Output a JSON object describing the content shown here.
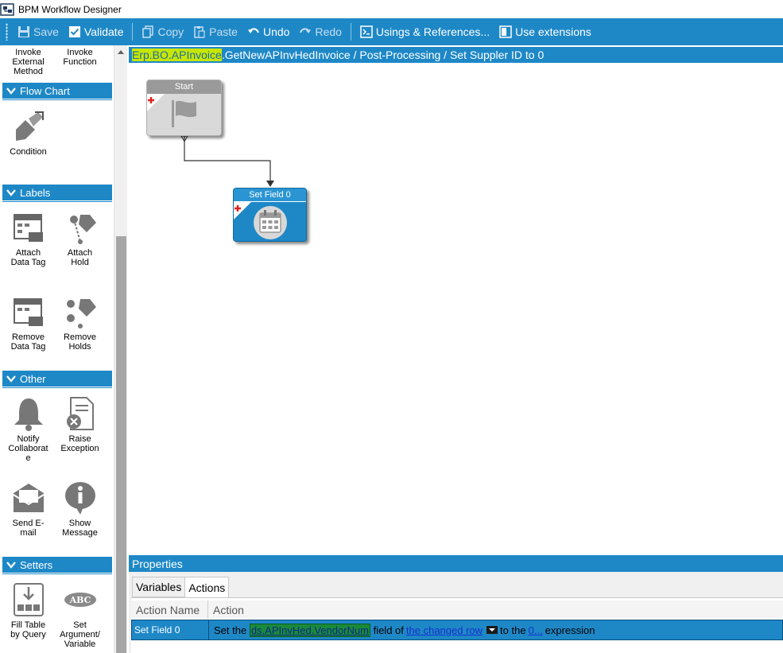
{
  "window": {
    "title": "BPM Workflow Designer"
  },
  "toolbar": {
    "save": "Save",
    "validate": "Validate",
    "copy": "Copy",
    "paste": "Paste",
    "undo": "Undo",
    "redo": "Redo",
    "usings": "Usings & References...",
    "extensions": "Use extensions"
  },
  "toolbox": {
    "top_items": [
      {
        "label": "Invoke\nExternal\nMethod"
      },
      {
        "label": "Invoke\nFunction"
      }
    ],
    "groups": {
      "flowchart": {
        "title": "Flow Chart",
        "items": [
          {
            "label": "Condition",
            "icon": "condition-icon"
          }
        ]
      },
      "labels": {
        "title": "Labels",
        "items": [
          {
            "label": "Attach\nData Tag",
            "icon": "attach-data-tag-icon"
          },
          {
            "label": "Attach\nHold",
            "icon": "attach-hold-icon"
          },
          {
            "label": "Remove\nData Tag",
            "icon": "remove-data-tag-icon"
          },
          {
            "label": "Remove\nHolds",
            "icon": "remove-holds-icon"
          }
        ]
      },
      "other": {
        "title": "Other",
        "items": [
          {
            "label": "Notify\nCollaborat\ne",
            "icon": "bell-icon"
          },
          {
            "label": "Raise\nException",
            "icon": "raise-exception-icon"
          },
          {
            "label": "Send E-\nmail",
            "icon": "envelope-icon"
          },
          {
            "label": "Show\nMessage",
            "icon": "info-bubble-icon"
          }
        ]
      },
      "setters": {
        "title": "Setters",
        "items": [
          {
            "label": "Fill Table\nby Query",
            "icon": "fill-table-icon"
          },
          {
            "label": "Set\nArgument/\nVariable",
            "icon": "abc-icon"
          }
        ]
      }
    }
  },
  "breadcrumb": {
    "highlight": "Erp.BO.APInvoice",
    "rest": ".GetNewAPInvHedInvoice / Post-Processing / Set Suppler ID to 0"
  },
  "workflow": {
    "nodes": [
      {
        "title": "Start",
        "icon": "flag-icon"
      },
      {
        "title": "Set Field 0",
        "icon": "calendar-icon"
      }
    ]
  },
  "properties": {
    "title": "Properties",
    "tabs": [
      {
        "label": "Variables"
      },
      {
        "label": "Actions"
      }
    ],
    "active_tab": "Actions",
    "columns": {
      "action_name": "Action Name",
      "action": "Action"
    },
    "rows": [
      {
        "name": "Set Field 0",
        "part1": "Set the",
        "field": "ds.APInvHed.VendorNum",
        "part2": "field of",
        "row_link": "the changed row",
        "part3": "to the",
        "value_link": "0...",
        "part4": "expression"
      }
    ]
  },
  "colors": {
    "accent": "#1e88c7",
    "highlight": "#c8e600",
    "field_highlight": "#1a8a3a"
  }
}
